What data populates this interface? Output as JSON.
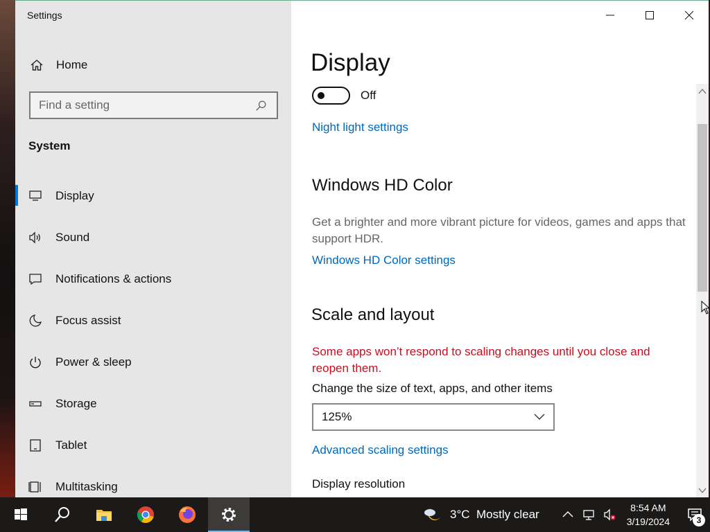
{
  "window": {
    "title": "Settings",
    "controls": [
      "minimize",
      "maximize",
      "close"
    ]
  },
  "sidebar": {
    "home_label": "Home",
    "search_placeholder": "Find a setting",
    "section_title": "System",
    "items": [
      {
        "label": "Display",
        "icon": "monitor-icon",
        "active": true
      },
      {
        "label": "Sound",
        "icon": "speaker-icon"
      },
      {
        "label": "Notifications & actions",
        "icon": "message-icon"
      },
      {
        "label": "Focus assist",
        "icon": "moon-icon"
      },
      {
        "label": "Power & sleep",
        "icon": "power-icon"
      },
      {
        "label": "Storage",
        "icon": "storage-icon"
      },
      {
        "label": "Tablet",
        "icon": "tablet-icon"
      },
      {
        "label": "Multitasking",
        "icon": "multitasking-icon"
      }
    ]
  },
  "main": {
    "page_title": "Display",
    "night_light_state": "Off",
    "night_light_link": "Night light settings",
    "hd_color": {
      "heading": "Windows HD Color",
      "description": "Get a brighter and more vibrant picture for videos, games and apps that support HDR.",
      "link": "Windows HD Color settings"
    },
    "scale": {
      "heading": "Scale and layout",
      "warning": "Some apps won’t respond to scaling changes until you close and reopen them.",
      "size_label": "Change the size of text, apps, and other items",
      "size_value": "125%",
      "advanced_link": "Advanced scaling settings",
      "resolution_label": "Display resolution"
    }
  },
  "taskbar": {
    "apps": [
      "windows-start-icon",
      "search-icon",
      "file-explorer-icon",
      "chrome-icon",
      "firefox-icon",
      "settings-icon"
    ],
    "weather": {
      "temp": "3°C",
      "condition": "Mostly clear"
    },
    "time": "8:54 AM",
    "date": "3/19/2024",
    "notification_count": "3"
  },
  "colors": {
    "accent": "#0078d7",
    "link": "#0067b8",
    "warning": "#c50f1f",
    "sidebar_bg": "#e6e6e6",
    "taskbar_bg": "#1b1a19"
  }
}
